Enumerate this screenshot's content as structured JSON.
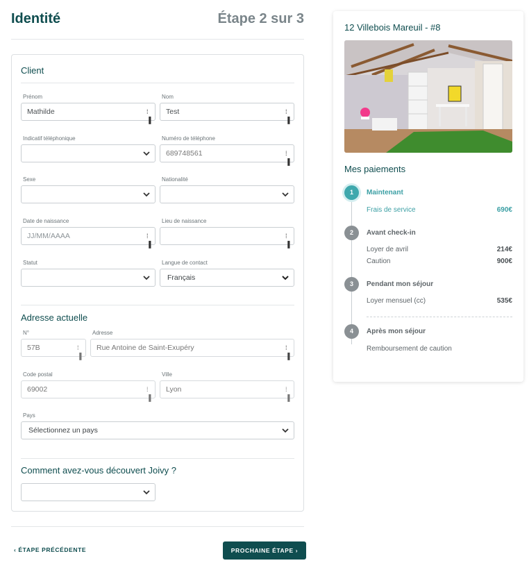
{
  "header": {
    "title": "Identité",
    "step": "Étape 2 sur 3"
  },
  "client": {
    "title": "Client",
    "prenom": {
      "label": "Prénom",
      "value": "Mathilde"
    },
    "nom": {
      "label": "Nom",
      "value": "Test"
    },
    "indicatif": {
      "label": "Indicatif téléphonique",
      "value": ""
    },
    "telephone": {
      "label": "Numéro de téléphone",
      "value": "689748561"
    },
    "sexe": {
      "label": "Sexe",
      "value": ""
    },
    "nationalite": {
      "label": "Nationalité",
      "value": ""
    },
    "date_naissance": {
      "label": "Date de naissance",
      "placeholder": "JJ/MM/AAAA"
    },
    "lieu_naissance": {
      "label": "Lieu de naissance",
      "value": ""
    },
    "statut": {
      "label": "Statut",
      "value": ""
    },
    "langue": {
      "label": "Langue de contact",
      "value": "Français"
    }
  },
  "adresse": {
    "title": "Adresse actuelle",
    "numero": {
      "label": "N°",
      "value": "57B"
    },
    "adresse": {
      "label": "Adresse",
      "value": "Rue Antoine de Saint-Exupéry"
    },
    "code_postal": {
      "label": "Code postal",
      "value": "69002"
    },
    "ville": {
      "label": "Ville",
      "value": "Lyon"
    },
    "pays": {
      "label": "Pays",
      "value": "Sélectionnez un pays"
    }
  },
  "decouverte": {
    "title": "Comment avez-vous découvert Joivy ?",
    "value": ""
  },
  "footer": {
    "prev": "ÉTAPE PRÉCÉDENTE",
    "next": "PROCHAINE ÉTAPE"
  },
  "sidebar": {
    "title": "12 Villebois Mareuil - #8",
    "payments_title": "Mes paiements",
    "steps": [
      {
        "num": "1",
        "title": "Maintenant",
        "items": [
          {
            "label": "Frais de service",
            "amount": "690€"
          }
        ]
      },
      {
        "num": "2",
        "title": "Avant check-in",
        "items": [
          {
            "label": "Loyer de avril",
            "amount": "214€"
          },
          {
            "label": "Caution",
            "amount": "900€"
          }
        ]
      },
      {
        "num": "3",
        "title": "Pendant mon séjour",
        "items": [
          {
            "label": "Loyer mensuel (cc)",
            "amount": "535€"
          }
        ]
      },
      {
        "num": "4",
        "title": "Après mon séjour",
        "items": [
          {
            "label": "Remboursement de caution",
            "amount": ""
          }
        ]
      }
    ]
  },
  "colors": {
    "brand": "#0f4d4f",
    "accent": "#3fa8ad",
    "muted": "#8a9094"
  },
  "icons": {
    "field_handle": "password-manager-icon",
    "select": "chevron-down-icon",
    "prev": "chevron-left-icon",
    "next": "chevron-right-icon"
  }
}
